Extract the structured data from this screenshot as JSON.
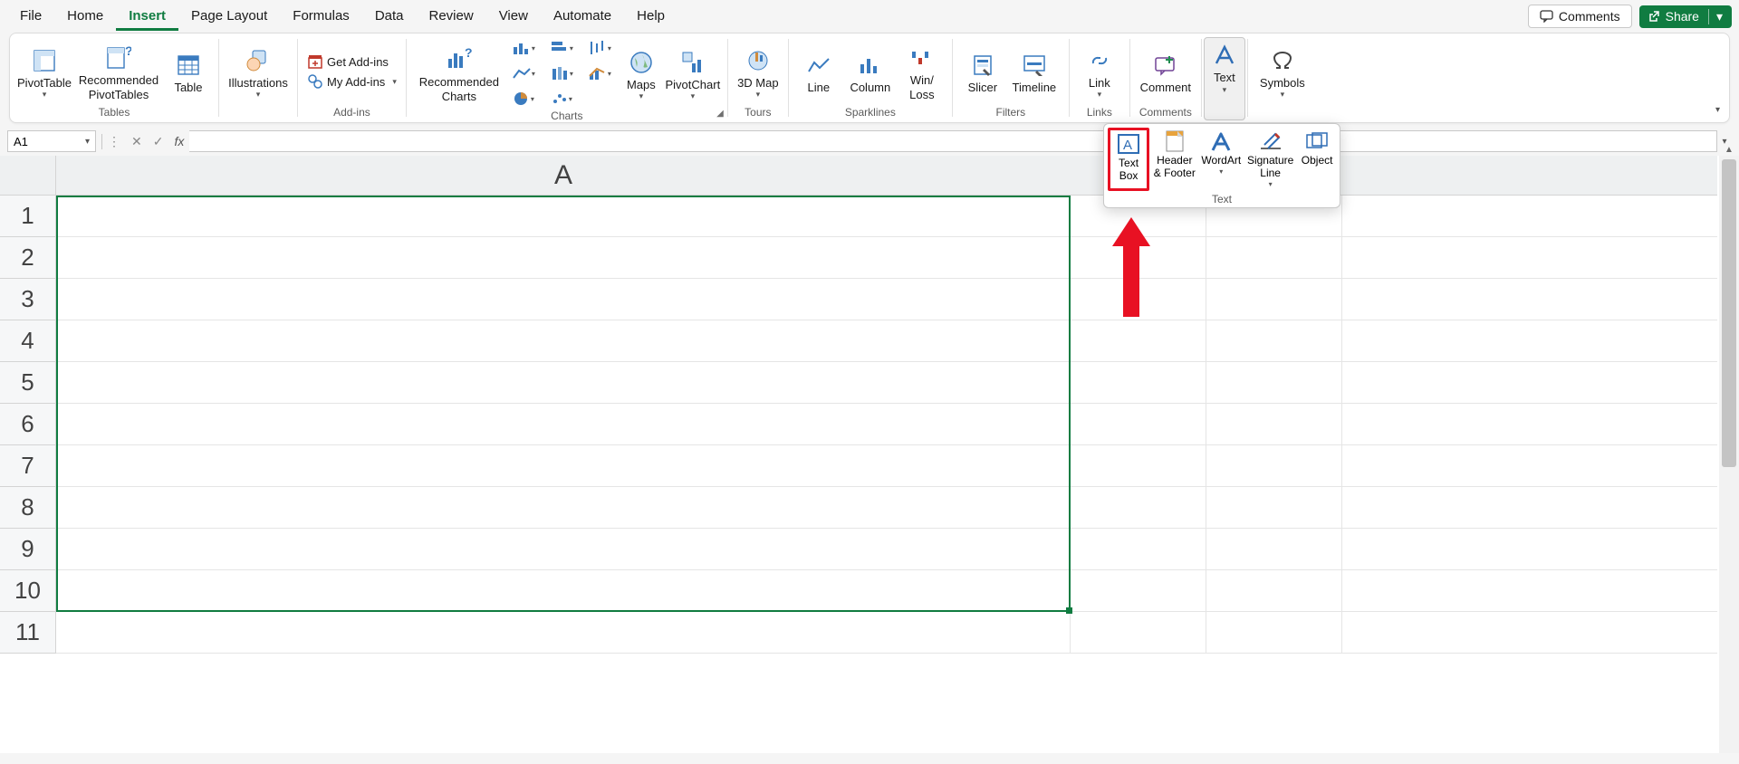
{
  "tabs": {
    "file": "File",
    "home": "Home",
    "insert": "Insert",
    "pagelayout": "Page Layout",
    "formulas": "Formulas",
    "data": "Data",
    "review": "Review",
    "view": "View",
    "automate": "Automate",
    "help": "Help"
  },
  "topbar": {
    "comments": "Comments",
    "share": "Share"
  },
  "ribbon": {
    "groups": {
      "tables": "Tables",
      "illustrations_btn": "Illustrations",
      "addins": "Add-ins",
      "charts": "Charts",
      "tours": "Tours",
      "sparklines": "Sparklines",
      "filters": "Filters",
      "links": "Links",
      "comments": "Comments",
      "symbols_btn": "Symbols"
    },
    "buttons": {
      "pivottable": "PivotTable",
      "rec_pivot": "Recommended PivotTables",
      "table": "Table",
      "get_addins": "Get Add-ins",
      "my_addins": "My Add-ins",
      "rec_charts": "Recommended Charts",
      "maps": "Maps",
      "pivotchart": "PivotChart",
      "map3d": "3D Map",
      "line": "Line",
      "column": "Column",
      "winloss": "Win/\nLoss",
      "slicer": "Slicer",
      "timeline": "Timeline",
      "link": "Link",
      "comment": "Comment",
      "text": "Text"
    }
  },
  "text_panel": {
    "textbox": "Text\nBox",
    "headerfooter": "Header\n& Footer",
    "wordart": "WordArt",
    "signature": "Signature\nLine",
    "object": "Object",
    "group_label": "Text"
  },
  "formula_bar": {
    "name_box": "A1",
    "fx": "fx"
  },
  "grid": {
    "column": "A",
    "rows": [
      "1",
      "2",
      "3",
      "4",
      "5",
      "6",
      "7",
      "8",
      "9",
      "10",
      "11"
    ]
  }
}
